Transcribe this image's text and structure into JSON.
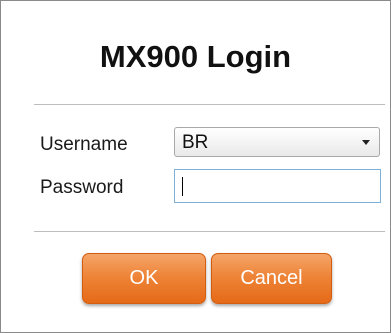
{
  "dialog": {
    "title": "MX900 Login"
  },
  "form": {
    "username_label": "Username",
    "username_selected": "BR",
    "password_label": "Password",
    "password_value": ""
  },
  "buttons": {
    "ok_label": "OK",
    "cancel_label": "Cancel"
  },
  "colors": {
    "button_orange": "#ee8438",
    "input_focus_border": "#7fb1d8",
    "frame_border": "#8a8a8a"
  },
  "icons": {
    "dropdown": "chevron-down-icon"
  }
}
